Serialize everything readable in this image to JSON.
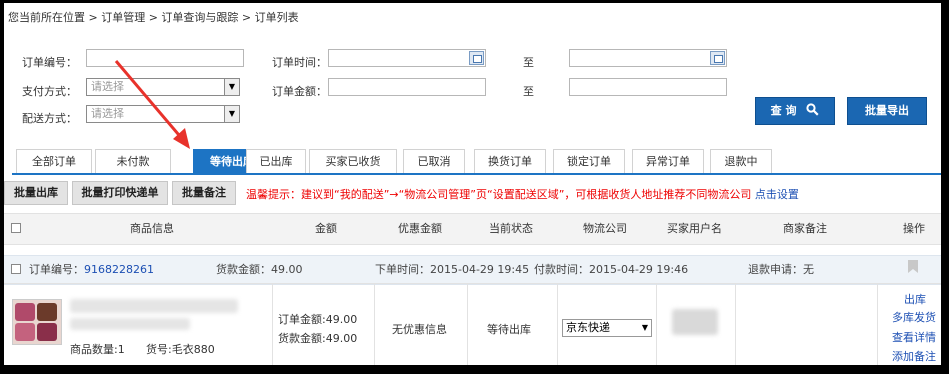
{
  "breadcrumb": "您当前所在位置 > 订单管理 > 订单查询与跟踪 > 订单列表",
  "filters": {
    "order_no_label": "订单编号：",
    "pay_label": "支付方式：",
    "pay_placeholder": "请选择",
    "ship_label": "配送方式：",
    "ship_placeholder": "请选择",
    "order_time_label": "订单时间：",
    "order_amount_label": "订单金额：",
    "to_label": "至"
  },
  "buttons": {
    "query": "查 询",
    "export": "批量导出"
  },
  "tabs": [
    "全部订单",
    "未付款",
    "等待出库",
    "已出库",
    "买家已收货",
    "已取消",
    "换货订单",
    "锁定订单",
    "异常订单",
    "退款中"
  ],
  "active_tab": "等待出库",
  "actions": [
    "批量出库",
    "批量打印快递单",
    "批量备注"
  ],
  "tip": {
    "text": "温馨提示：建议到“我的配送”→“物流公司管理”页“设置配送区域”，可根据收货人地址推荐不同物流公司",
    "link": "点击设置"
  },
  "columns": [
    "商品信息",
    "金额",
    "优惠金额",
    "当前状态",
    "物流公司",
    "买家用户名",
    "商家备注",
    "操作"
  ],
  "order": {
    "no_label": "订单编号：",
    "no": "9168228261",
    "goods_amount": "货款金额：49.00",
    "order_time": "下单时间：2015-04-29 19:45",
    "pay_time": "付款时间：2015-04-29 19:46",
    "refund": "退款申请：无",
    "qty": "商品数量:1",
    "sku": "货号:毛衣880",
    "amount_order": "订单金额:49.00",
    "amount_goods": "货款金额:49.00",
    "discount": "无优惠信息",
    "status": "等待出库",
    "logistics": "京东快递",
    "ops": [
      "出库",
      "多库发货",
      "查看详情",
      "添加备注"
    ]
  },
  "colors": {
    "accent": "#1d74c4",
    "button_blue": "#1b67b2",
    "tip_red": "#e00000",
    "link_blue": "#1c4fb3",
    "annotation_arrow": "#e8322b"
  }
}
